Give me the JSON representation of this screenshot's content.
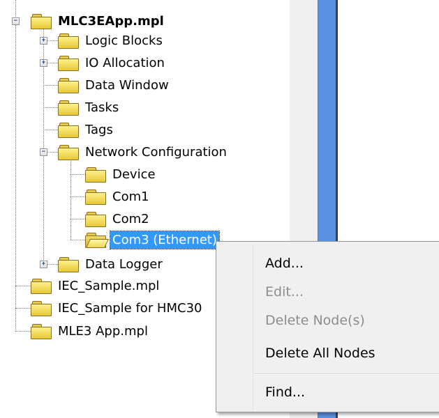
{
  "tree": {
    "root": {
      "label": "MLC3EApp.mpl"
    },
    "children": [
      {
        "label": "Logic Blocks"
      },
      {
        "label": "IO Allocation"
      },
      {
        "label": "Data Window"
      },
      {
        "label": "Tasks"
      },
      {
        "label": "Tags"
      },
      {
        "label": "Network Configuration"
      },
      {
        "label": "Data Logger"
      }
    ],
    "network_children": [
      {
        "label": "Device"
      },
      {
        "label": "Com1"
      },
      {
        "label": "Com2"
      },
      {
        "label": "Com3 (Ethernet)"
      }
    ],
    "siblings": [
      {
        "label": "IEC_Sample.mpl"
      },
      {
        "label": "IEC_Sample for HMC30"
      },
      {
        "label": "MLE3 App.mpl"
      }
    ],
    "expanded_symbol": "−",
    "collapsed_symbol": "+"
  },
  "context_menu": {
    "items": [
      {
        "label": "Add...",
        "enabled": true
      },
      {
        "label": "Edit...",
        "enabled": false
      },
      {
        "label": "Delete Node(s)",
        "enabled": false
      },
      {
        "label": "Delete All Nodes",
        "enabled": true
      },
      {
        "label": "Find...",
        "enabled": true
      }
    ]
  },
  "colors": {
    "selection": "#3399ff",
    "folder": "#f0d650",
    "pane_divider": "#5b8fe0",
    "menu_background": "#f0f0f0",
    "disabled_text": "#8d8d8d"
  }
}
